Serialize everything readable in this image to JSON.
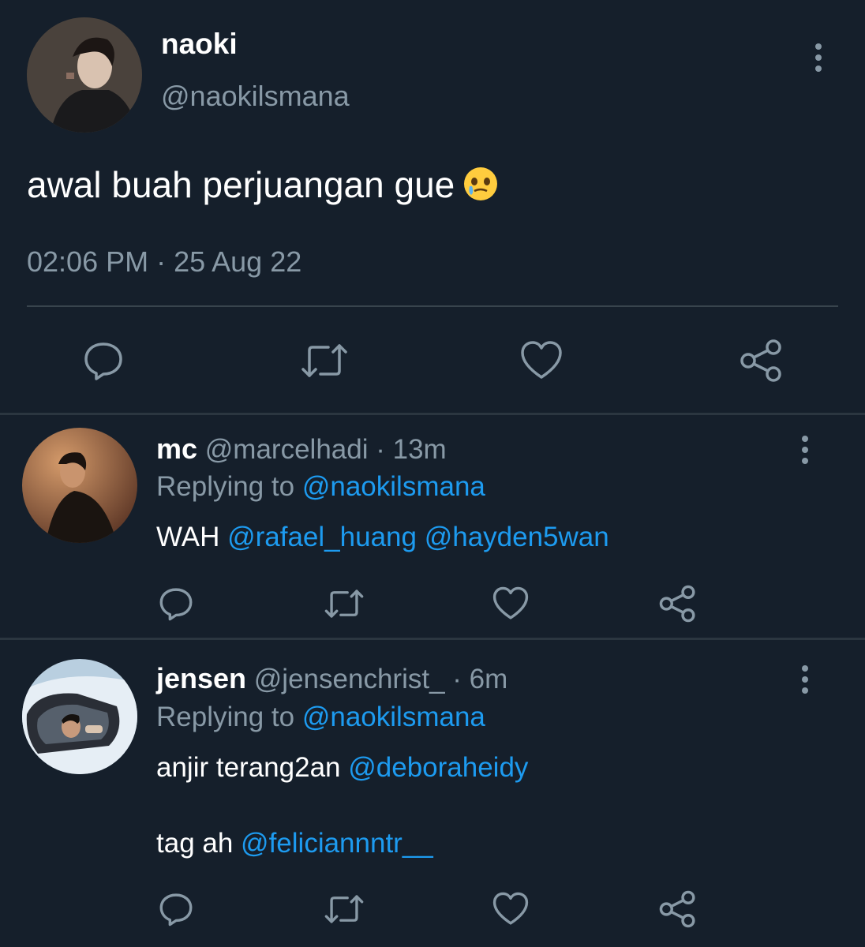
{
  "main_tweet": {
    "name": "naoki",
    "handle": "@naokilsmana",
    "text": "awal buah perjuangan gue",
    "emoji": "face-holding-back-tears-emoji",
    "timestamp": "02:06 PM · 25 Aug 22",
    "actions": [
      "reply-icon",
      "retweet-icon",
      "like-icon",
      "share-icon"
    ]
  },
  "replies": [
    {
      "name": "mc",
      "handle": "@marcelhadi",
      "time": "· 13m",
      "replying_label": "Replying to",
      "replying_handle": "@naokilsmana",
      "body_line1_text": "WAH",
      "body_line1_mention1": "@rafael_huang",
      "body_line1_mention2": "@hayden5wan"
    },
    {
      "name": "jensen",
      "handle": "@jensenchrist_",
      "time": "· 6m",
      "replying_label": "Replying to",
      "replying_handle": "@naokilsmana",
      "body_line1_text": "anjir terang2an",
      "body_line1_mention": "@deboraheidy",
      "body_line2_text": "tag ah",
      "body_line2_mention": "@feliciannntr__"
    }
  ],
  "colors": {
    "background": "#151f2b",
    "text": "#ffffff",
    "muted": "#8899a6",
    "link": "#1d9bf0",
    "divider": "#38444d"
  }
}
